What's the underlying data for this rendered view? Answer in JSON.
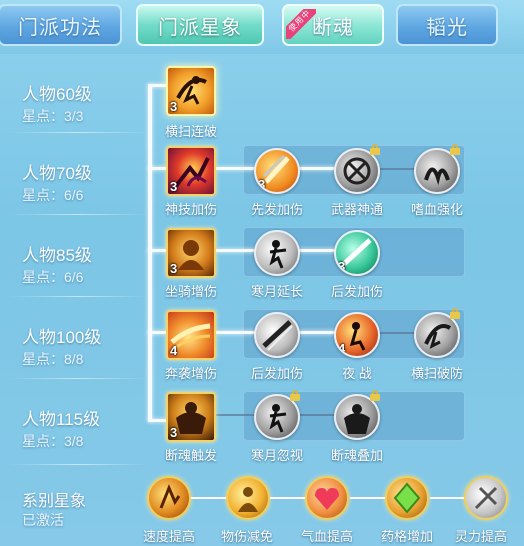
{
  "tabs": [
    {
      "label": "门派功法",
      "state": "inactive"
    },
    {
      "label": "门派星象",
      "state": "active"
    },
    {
      "label": "断魂",
      "state": "inactive",
      "badge": "使用中"
    },
    {
      "label": "韬光",
      "state": "inactive"
    }
  ],
  "rows": [
    {
      "level": "人物60级",
      "stars": "星点：3/3",
      "main": {
        "label": "横扫连破",
        "icon": "sweeping-strike-icon",
        "count": "3",
        "selected": true
      },
      "subs": []
    },
    {
      "level": "人物70级",
      "stars": "星点：6/6",
      "main": {
        "label": "神技加伤",
        "icon": "divine-skill-icon",
        "count": "3"
      },
      "subs": [
        {
          "label": "先发加伤",
          "icon": "first-strike-icon",
          "count": "3",
          "locked": false
        },
        {
          "label": "武器神通",
          "icon": "weapon-mastery-icon",
          "count": "",
          "locked": true
        },
        {
          "label": "嗜血强化",
          "icon": "bloodthirst-icon",
          "count": "",
          "locked": true
        }
      ]
    },
    {
      "level": "人物85级",
      "stars": "星点：6/6",
      "main": {
        "label": "坐骑增伤",
        "icon": "mount-damage-icon",
        "count": "3"
      },
      "subs": [
        {
          "label": "寒月延长",
          "icon": "cold-moon-icon",
          "count": "",
          "locked": false
        },
        {
          "label": "后发加伤",
          "icon": "late-strike-icon",
          "count": "3",
          "locked": false
        }
      ]
    },
    {
      "level": "人物100级",
      "stars": "星点：8/8",
      "main": {
        "label": "奔袭增伤",
        "icon": "charge-damage-icon",
        "count": "4"
      },
      "subs": [
        {
          "label": "后发加伤",
          "icon": "late-strike-icon",
          "count": "",
          "locked": false
        },
        {
          "label": "夜 战",
          "icon": "night-battle-icon",
          "count": "4",
          "locked": false
        },
        {
          "label": "横扫破防",
          "icon": "sweep-break-icon",
          "count": "",
          "locked": true
        }
      ]
    },
    {
      "level": "人物115级",
      "stars": "星点：3/8",
      "main": {
        "label": "断魂触发",
        "icon": "soul-break-icon",
        "count": "3"
      },
      "subs": [
        {
          "label": "寒月忽视",
          "icon": "cold-moon-ignore-icon",
          "count": "",
          "locked": true
        },
        {
          "label": "断魂叠加",
          "icon": "soul-stack-icon",
          "count": "",
          "locked": true
        }
      ]
    }
  ],
  "series": {
    "title": "系别星象",
    "status": "已激活",
    "items": [
      {
        "label": "速度提高",
        "icon": "speed-up-icon"
      },
      {
        "label": "物伤减免",
        "icon": "physical-reduction-icon"
      },
      {
        "label": "气血提高",
        "icon": "health-up-icon"
      },
      {
        "label": "药格增加",
        "icon": "potion-slot-icon"
      },
      {
        "label": "灵力提高",
        "icon": "spirit-up-icon"
      }
    ]
  },
  "colors": {
    "background": "#86c9e8",
    "active_tab": "#4fc7b2",
    "inactive_tab": "#4b93d4",
    "badge": "#e8437a",
    "border_gold": "#f2d36b"
  }
}
